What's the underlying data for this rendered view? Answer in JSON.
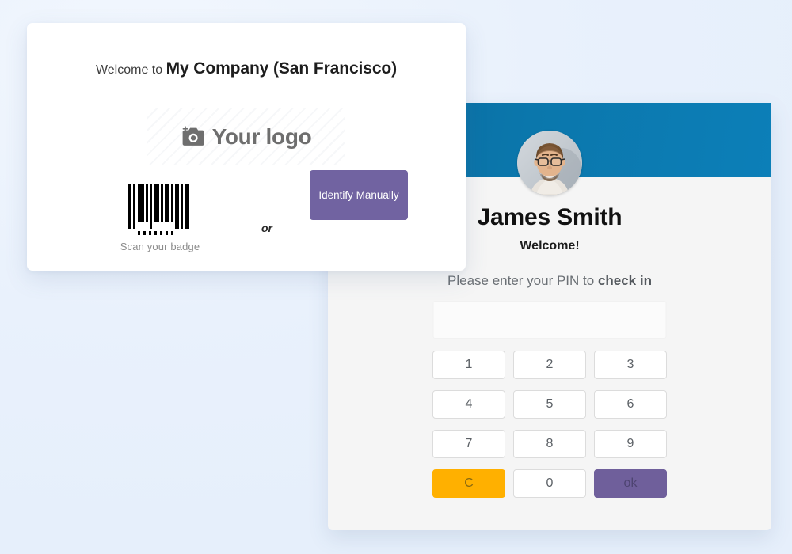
{
  "theme": {
    "page_background": "#eaf2fd",
    "panel_header_blue": "#0b77ac",
    "accent_purple": "#7163a1",
    "clear_amber": "#ffb000",
    "card_white": "#ffffff",
    "panel_gray": "#f5f5f5"
  },
  "kiosk_card": {
    "welcome_prefix": "Welcome to ",
    "company_name": "My Company (San Francisco)",
    "logo_placeholder": {
      "text": "Your logo",
      "icon": "add-photo-camera-icon"
    },
    "scan": {
      "icon": "barcode-icon",
      "label": "Scan your badge"
    },
    "separator_text": "or",
    "identify_button_label": "Identify Manually"
  },
  "checkin_panel": {
    "avatar": {
      "icon": "user-photo-avatar",
      "alt": "James Smith profile photo"
    },
    "user_name": "James Smith",
    "welcome_message": "Welcome!",
    "pin_prompt_prefix": "Please enter your PIN to ",
    "pin_prompt_action": "check in",
    "pin_value": "",
    "pin_placeholder": "",
    "keypad": [
      {
        "label": "1",
        "role": "digit"
      },
      {
        "label": "2",
        "role": "digit"
      },
      {
        "label": "3",
        "role": "digit"
      },
      {
        "label": "4",
        "role": "digit"
      },
      {
        "label": "5",
        "role": "digit"
      },
      {
        "label": "6",
        "role": "digit"
      },
      {
        "label": "7",
        "role": "digit"
      },
      {
        "label": "8",
        "role": "digit"
      },
      {
        "label": "9",
        "role": "digit"
      },
      {
        "label": "C",
        "role": "clear"
      },
      {
        "label": "0",
        "role": "digit"
      },
      {
        "label": "ok",
        "role": "confirm"
      }
    ]
  }
}
